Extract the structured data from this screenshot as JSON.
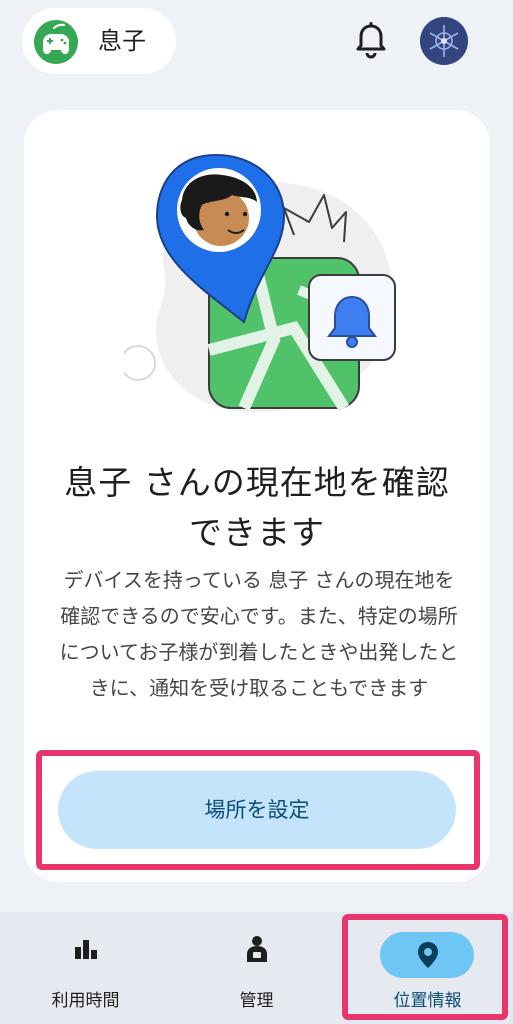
{
  "header": {
    "child_name": "息子"
  },
  "card": {
    "title_line1": "息子 さんの現在地を確認",
    "title_line2": "できます",
    "description": "デバイスを持っている 息子 さんの現在地を確認できるので安心です。また、特定の場所についてお子様が到着したときや出発したときに、通知を受け取ることもできます",
    "cta_label": "場所を設定"
  },
  "nav": {
    "items": [
      {
        "label": "利用時間",
        "icon": "bar-chart-icon"
      },
      {
        "label": "管理",
        "icon": "person-badge-icon"
      },
      {
        "label": "位置情報",
        "icon": "location-pin-icon",
        "active": true
      }
    ]
  },
  "colors": {
    "accent": "#c3e4fb",
    "active_nav": "#6ec6f5",
    "highlight": "#e8356d",
    "child_avatar": "#34a853"
  }
}
